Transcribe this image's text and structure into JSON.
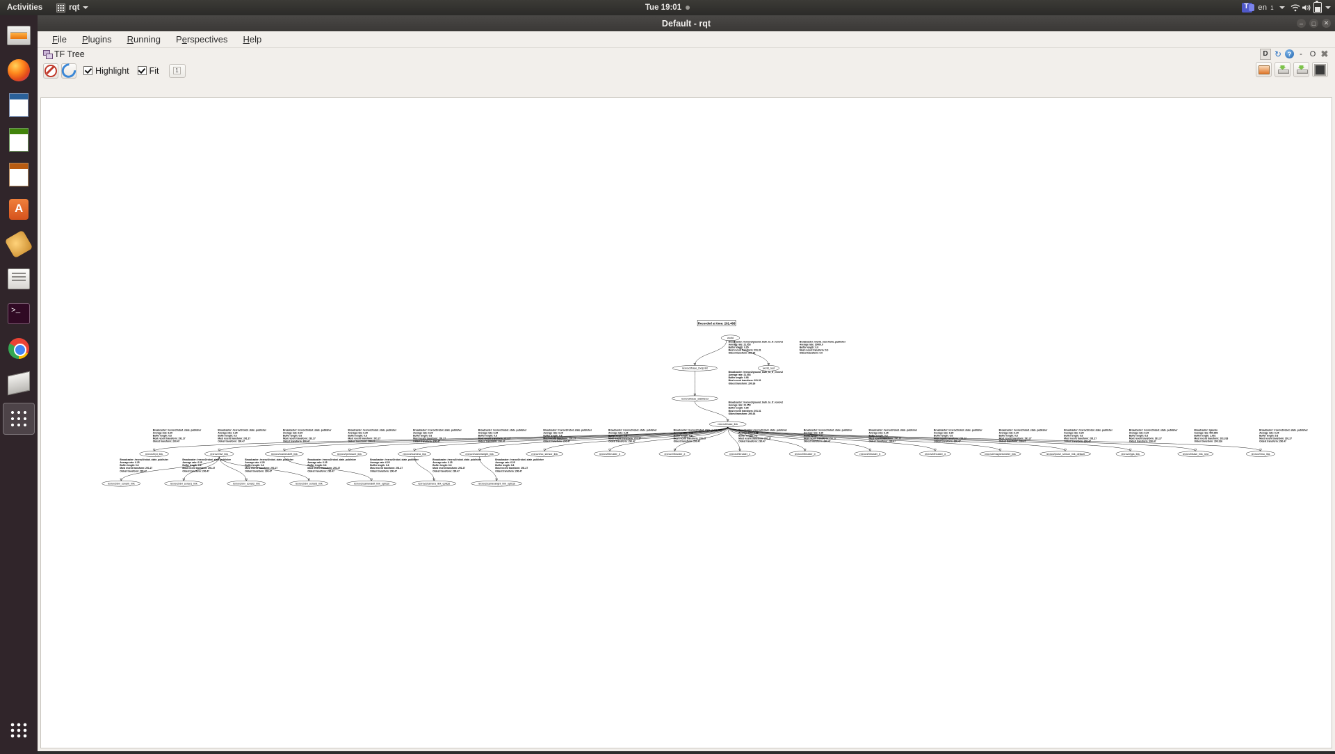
{
  "topbar": {
    "activities": "Activities",
    "app_name": "rqt",
    "clock": "Tue 19:01",
    "keyboard": "en",
    "keyboard_sub": "1",
    "icons": [
      "waffle-icon",
      "caret-down-icon",
      "recording-dot-icon",
      "teams-icon",
      "wifi-icon",
      "volume-icon",
      "battery-icon",
      "system-caret-icon"
    ]
  },
  "launcher": {
    "items": [
      {
        "name": "files",
        "label": "Files"
      },
      {
        "name": "firefox",
        "label": "Firefox Web Browser"
      },
      {
        "name": "writer",
        "label": "LibreOffice Writer"
      },
      {
        "name": "calc",
        "label": "LibreOffice Calc"
      },
      {
        "name": "impress",
        "label": "LibreOffice Impress"
      },
      {
        "name": "software",
        "label": "Ubuntu Software"
      },
      {
        "name": "settings",
        "label": "Settings"
      },
      {
        "name": "text-editor",
        "label": "Text Editor"
      },
      {
        "name": "terminal",
        "label": "Terminal"
      },
      {
        "name": "chrome",
        "label": "Google Chrome"
      },
      {
        "name": "blender",
        "label": "Blender"
      },
      {
        "name": "app-grid",
        "label": "Show Applications"
      },
      {
        "name": "all-apps",
        "label": "All Applications"
      }
    ]
  },
  "window": {
    "title": "Default - rqt",
    "controls": [
      "minimize",
      "maximize",
      "close"
    ]
  },
  "menubar": {
    "items": [
      {
        "label": "File",
        "mnemonic": "F"
      },
      {
        "label": "Plugins",
        "mnemonic": "P"
      },
      {
        "label": "Running",
        "mnemonic": "R"
      },
      {
        "label": "Perspectives",
        "mnemonic": "P"
      },
      {
        "label": "Help",
        "mnemonic": "H"
      }
    ]
  },
  "plugin": {
    "title": "TF Tree",
    "dock_buttons": [
      "D",
      "reload-icon",
      "help-icon",
      "minimize",
      "maximize",
      "close-icon"
    ],
    "dock_labels": {
      "d": "D",
      "minimize": "-",
      "maximize": "O",
      "close": "✖"
    }
  },
  "toolbar": {
    "stop_button": "stop-icon",
    "refresh_button": "refresh-icon",
    "highlight_label": "Highlight",
    "highlight_checked": true,
    "fit_label": "Fit",
    "fit_checked": true,
    "spin_value": "1",
    "right_buttons": [
      "load-dot-file",
      "save-as-dot",
      "save-as-svg",
      "save-as-image"
    ]
  },
  "graph": {
    "recorded_label": "Recorded at time: 291.468",
    "broadcasters": {
      "ground_truth": {
        "broadcaster": "Broadcaster: /rexrov2/ground_truth_to_tf_rexrov2",
        "average_rate": "Average rate: 21.053",
        "buffer_length": "Buffer length: 0.95",
        "most_recent": "Most recent transform: 291.31",
        "oldest": "Oldest transform: 290.36"
      },
      "world_ned": {
        "broadcaster": "Broadcaster: /world_ned_frame_publisher",
        "average_rate": "Average rate: 10000.0",
        "buffer_length": "Buffer length: 0.0",
        "most_recent": "Most recent transform: 0.0",
        "oldest": "Oldest transform: 0.0"
      },
      "robot_state": {
        "broadcaster": "Broadcaster: /rexrov2/robot_state_publisher",
        "average_rate": "Average rate: 6.25",
        "buffer_length": "Buffer length: 0.8",
        "most_recent": "Most recent transform: 291.27",
        "oldest": "Oldest transform: 290.47"
      },
      "gazebo": {
        "broadcaster": "Broadcaster: /gazebo",
        "average_rate": "Average rate: 500.998",
        "buffer_length": "Buffer length: 1.002",
        "most_recent": "Most recent transform: 291.318",
        "oldest": "Oldest transform: 290.316"
      }
    },
    "nodes": {
      "world": "world",
      "world_ned": "world_ned",
      "base_footprint": "rexrov2/base_footprint",
      "base_stabilized": "rexrov2/base_stabilized",
      "base_link": "rexrov2/base_link"
    },
    "leaf_nodes": [
      "rexrov2/rpt_link",
      "rexrov2/dvl_link",
      "rexrov2/cameraleft_link",
      "rexrov2/pressure_link",
      "rexrov2/camera_link",
      "rexrov2/cameraright_link",
      "rexrov2/cc_sensor_link",
      "rexrov2/thruster_3",
      "rexrov2/thruster_2",
      "rexrov2/thruster_1",
      "rexrov2/thruster_0",
      "rexrov2/thruster_5",
      "rexrov2/thruster_4",
      "rexrov2/magnetometer_link",
      "rexrov2/pose_sensor_link_default",
      "rexrov2/gps_link",
      "rexrov2/base_link_ned",
      "rexrov2/imu_link"
    ],
    "bottom_nodes": [
      "rexrov2/dvl_sonar0_link",
      "rexrov2/dvl_sonar1_link",
      "rexrov2/dvl_sonar2_link",
      "rexrov2/dvl_sonar3_link",
      "rexrov2/cameraleft_link_optical",
      "rexrov2/camera_link_optical",
      "rexrov2/cameraright_link_optical"
    ]
  }
}
